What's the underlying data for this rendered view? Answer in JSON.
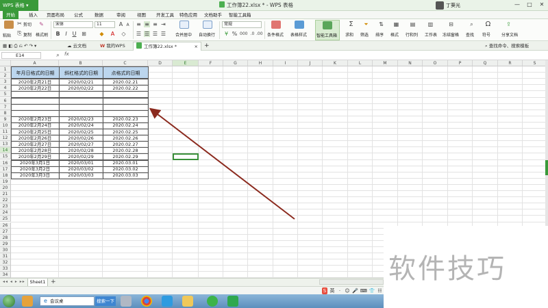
{
  "titlebar": {
    "app_name": "WPS 表格",
    "document_title": "工作簿22.xlsx * - WPS 表格",
    "user_name": "丁葵光",
    "window_controls": [
      "—",
      "□",
      "✕"
    ]
  },
  "menu": {
    "tabs": [
      "开始",
      "插入",
      "页面布局",
      "公式",
      "数据",
      "审阅",
      "视图",
      "开发工具",
      "特色应用",
      "文档助手",
      "智能工具箱"
    ],
    "active": "开始"
  },
  "ribbon": {
    "paste": "粘贴",
    "cut": "剪切",
    "copy": "复制",
    "format_painter": "格式刷",
    "font_name": "宋体",
    "font_size": "11",
    "merge_center": "合并居中",
    "wrap_text": "自动换行",
    "number_format": "常规",
    "conditional_format": "条件格式",
    "table_style": "表格样式",
    "smart_toolbox": "智能工具箱",
    "sum": "求和",
    "filter": "筛选",
    "sort": "排序",
    "format": "格式",
    "row_col": "行和列",
    "worksheet": "工作表",
    "freeze": "冻结窗格",
    "find": "查找",
    "symbol": "符号",
    "share": "分享文档"
  },
  "doc_tabs": {
    "items": [
      "云文档",
      "我的WPS",
      "工作簿22.xlsx *"
    ],
    "active_index": 2,
    "search_placeholder": "查找命令、搜索模板"
  },
  "formula_bar": {
    "name_box": "E14",
    "fx": "fx",
    "content": ""
  },
  "grid": {
    "columns": [
      "A",
      "B",
      "C",
      "D",
      "E",
      "F",
      "G",
      "H",
      "I",
      "J",
      "K",
      "L",
      "M",
      "N",
      "O",
      "P",
      "Q",
      "R",
      "S"
    ],
    "selected_column": "E",
    "selected_row": 14,
    "row_count": 35,
    "headers": [
      "年月日格式的日期",
      "斜杠格式的日期",
      "点格式的日期"
    ],
    "rows": [
      {
        "row": 2,
        "a": "2020年2月21日",
        "b": "2020/02/21",
        "c": "2020.02.21"
      },
      {
        "row": 3,
        "a": "2020年2月22日",
        "b": "2020/02/22",
        "c": "2020.02.22"
      },
      {
        "row": 8,
        "a": "2020年2月23日",
        "b": "2020/02/23",
        "c": "2020.02.23"
      },
      {
        "row": 9,
        "a": "2020年2月24日",
        "b": "2020/02/24",
        "c": "2020.02.24"
      },
      {
        "row": 10,
        "a": "2020年2月25日",
        "b": "2020/02/25",
        "c": "2020.02.25"
      },
      {
        "row": 11,
        "a": "2020年2月26日",
        "b": "2020/02/26",
        "c": "2020.02.26"
      },
      {
        "row": 12,
        "a": "2020年2月27日",
        "b": "2020/02/27",
        "c": "2020.02.27"
      },
      {
        "row": 13,
        "a": "2020年2月28日",
        "b": "2020/02/28",
        "c": "2020.02.28"
      },
      {
        "row": 14,
        "a": "2020年2月29日",
        "b": "2020/02/29",
        "c": "2020.02.29"
      },
      {
        "row": 15,
        "a": "2020年3月1日",
        "b": "2020/03/01",
        "c": "2020.03.01"
      },
      {
        "row": 16,
        "a": "2020年3月2日",
        "b": "2020/03/02",
        "c": "2020.03.02"
      },
      {
        "row": 17,
        "a": "2020年3月3日",
        "b": "2020/03/03",
        "c": "2020.03.03"
      }
    ]
  },
  "sheet_tabs": {
    "items": [
      "Sheet1"
    ],
    "add": "+",
    "nav": "◂◂ ◂ ▸ ▸▸"
  },
  "status": {
    "ime": [
      "S",
      "英",
      "·",
      "☺",
      "🎤",
      "⌨",
      "👕",
      "☷"
    ]
  },
  "taskbar": {
    "search_text": "会议桌",
    "search_button": "搜索一下"
  },
  "watermark": "软件技巧",
  "colors": {
    "accent_green": "#3a9a3a",
    "header_fill": "#bcd6ee",
    "arrow": "#8b2a1e"
  }
}
